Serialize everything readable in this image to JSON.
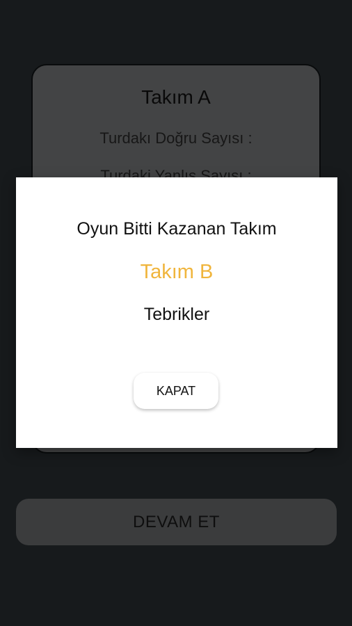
{
  "score_card": {
    "team_title": "Takım A",
    "correct_label": "Turdakı Doğru Sayısı :",
    "wrong_label": "Turdaki Yanlış Sayısı :"
  },
  "continue_button": {
    "label": "DEVAM ET"
  },
  "dialog": {
    "message": "Oyun Bitti Kazanan Takım",
    "winner": "Takım B",
    "congrats": "Tebrikler",
    "close_label": "KAPAT",
    "winner_color": "#f0b53c"
  }
}
